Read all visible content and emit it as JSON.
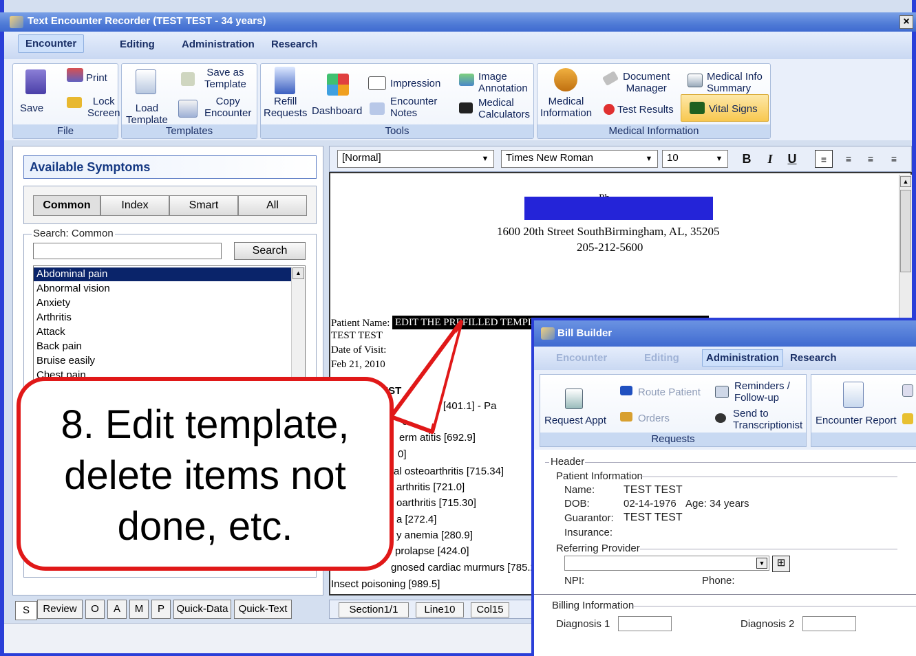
{
  "window": {
    "title": "Text Encounter Recorder (TEST TEST - 34 years)",
    "close": "×"
  },
  "menu": [
    "Encounter",
    "Editing",
    "Administration",
    "Research"
  ],
  "ribbon": {
    "save": "Save",
    "print": "Print",
    "lock": "Lock",
    "screen": "Screen",
    "file_group": "File",
    "load": "Load",
    "template": "Template",
    "save_as": "Save as",
    "save_as_2": "Template",
    "copy": "Copy",
    "encounter": "Encounter",
    "templates_group": "Templates",
    "refill": "Refill",
    "requests": "Requests",
    "dashboard": "Dashboard",
    "impression": "Impression",
    "enc_notes_1": "Encounter",
    "enc_notes_2": "Notes",
    "image_ann_1": "Image",
    "image_ann_2": "Annotation",
    "med_calc_1": "Medical",
    "med_calc_2": "Calculators",
    "tools_group": "Tools",
    "med_info_1": "Medical",
    "med_info_2": "Information",
    "doc_mgr_1": "Document",
    "doc_mgr_2": "Manager",
    "test_results": "Test Results",
    "med_sum_1": "Medical Info",
    "med_sum_2": "Summary",
    "vital_signs": "Vital Signs",
    "medinfo_group": "Medical Information"
  },
  "symptoms": {
    "title": "Available Symptoms",
    "tabs": [
      "Common",
      "Index",
      "Smart",
      "All"
    ],
    "search_label": "Search: Common",
    "search_button": "Search",
    "items": [
      "Abdominal pain",
      "Abnormal vision",
      "Anxiety",
      "Arthritis",
      "Attack",
      "Back pain",
      "Bruise easily",
      "Chest pain"
    ]
  },
  "bottom_tabs": [
    "S",
    "Review",
    "O",
    "A",
    "M",
    "P",
    "Quick-Data",
    "Quick-Text"
  ],
  "editor": {
    "style": "[Normal]",
    "font": "Times New Roman",
    "size": "10",
    "bold": "B",
    "italic": "I",
    "underline": "U",
    "status": [
      "Section1/1",
      "Line10",
      "Col15"
    ]
  },
  "document": {
    "header_partial": "Ph",
    "address": "1600 20th Street SouthBirmingham, AL, 35205",
    "phone": "205-212-5600",
    "patient_label": "Patient Name:",
    "patient_value": "EDIT THE PREFILLED TEMPL",
    "patient_name": "TEST TEST",
    "dov_label": "Date of Visit:",
    "dov_value": "Feb 21, 2010",
    "list_head": "IST",
    "lines": [
      "ertension [401.1] - Pa",
      "692.9]",
      "erm atitis [692.9]",
      "0]",
      "al osteoarthritis [715.34]",
      "arthritis [721.0]",
      "oarthritis [715.30]",
      "a [272.4]",
      "y anemia [280.9]",
      "prolapse [424.0]",
      "gnosed cardiac murmurs [785.2]",
      "Insect poisoning [989.5]"
    ]
  },
  "callout": {
    "line1": "8. Edit template,",
    "line2": "delete items not",
    "line3": "done, etc."
  },
  "bill_builder": {
    "title": "Bill Builder",
    "menu": [
      "Encounter",
      "Editing",
      "Administration",
      "Research"
    ],
    "request_appt": "Request Appt",
    "route_patient": "Route Patient",
    "orders": "Orders",
    "reminders_1": "Reminders /",
    "reminders_2": "Follow-up",
    "send_1": "Send to",
    "send_2": "Transcriptionist",
    "requests_group": "Requests",
    "encounter_report": "Encounter Report",
    "header": "Header",
    "patient_info": "Patient Information",
    "name_label": "Name:",
    "name_value": "TEST TEST",
    "dob_label": "DOB:",
    "dob_value": "02-14-1976",
    "age": "Age: 34 years",
    "guarantor_label": "Guarantor:",
    "guarantor_value": "TEST TEST",
    "insurance_label": "Insurance:",
    "referring": "Referring Provider",
    "npi": "NPI:",
    "phone": "Phone:",
    "billing": "Billing Information",
    "diag1": "Diagnosis 1",
    "diag2": "Diagnosis 2"
  }
}
